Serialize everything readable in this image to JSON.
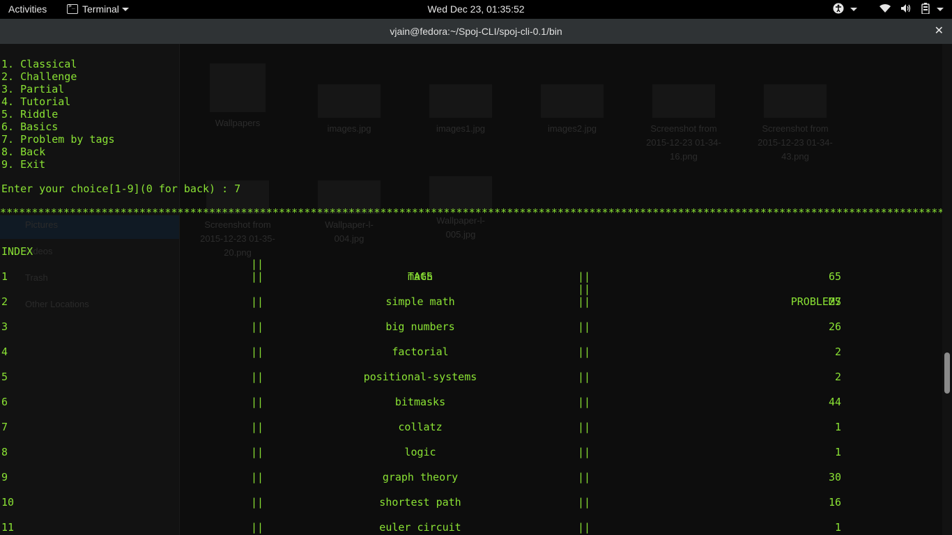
{
  "topbar": {
    "activities": "Activities",
    "app_name": "Terminal",
    "clock": "Wed Dec 23, 01:35:52",
    "icons": [
      "accessibility-icon",
      "wifi-icon",
      "volume-icon",
      "battery-icon"
    ]
  },
  "window": {
    "title": "vjain@fedora:~/Spoj-CLI/spoj-cli-0.1/bin",
    "close_label": "✕"
  },
  "terminal": {
    "menu": [
      "1. Classical",
      "2. Challenge",
      "3. Partial",
      "4. Tutorial",
      "5. Riddle",
      "6. Basics",
      "7. Problem by tags",
      "8. Back",
      "9. Exit"
    ],
    "prompt": "Enter your choice[1-9](0 for back) : 7",
    "stars": "******************************************************************************************************************************************************************************",
    "headers": {
      "index": "INDEX",
      "sep": "||",
      "tags": "TAGS",
      "problems": "PROBLEMS"
    },
    "rows": [
      {
        "index": "1",
        "tag": "math",
        "problems": "65"
      },
      {
        "index": "2",
        "tag": "simple math",
        "problems": "27"
      },
      {
        "index": "3",
        "tag": "big numbers",
        "problems": "26"
      },
      {
        "index": "4",
        "tag": "factorial",
        "problems": "2"
      },
      {
        "index": "5",
        "tag": "positional-systems",
        "problems": "2"
      },
      {
        "index": "6",
        "tag": "bitmasks",
        "problems": "44"
      },
      {
        "index": "7",
        "tag": "collatz",
        "problems": "1"
      },
      {
        "index": "8",
        "tag": "logic",
        "problems": "1"
      },
      {
        "index": "9",
        "tag": "graph theory",
        "problems": "30"
      },
      {
        "index": "10",
        "tag": "shortest path",
        "problems": "16"
      },
      {
        "index": "11",
        "tag": "euler circuit",
        "problems": "1"
      }
    ],
    "text_color": "#8ae234",
    "background_color": "#0d0d0d"
  },
  "background_files": [
    {
      "name": "Wallpapers",
      "kind": "folder"
    },
    {
      "name": "images.jpg",
      "kind": "image"
    },
    {
      "name": "images1.jpg",
      "kind": "image"
    },
    {
      "name": "images2.jpg",
      "kind": "image"
    },
    {
      "name": "Screenshot from 2015-12-23 01-34-16.png",
      "kind": "image"
    },
    {
      "name": "Screenshot from 2015-12-23 01-34-43.png",
      "kind": "image"
    },
    {
      "name": "Screenshot from 2015-12-23 01-35-20.png",
      "kind": "image"
    },
    {
      "name": "Wallpaper-l-004.jpg",
      "kind": "image"
    },
    {
      "name": "Wallpaper-l-005.jpg",
      "kind": "image"
    }
  ],
  "background_sidebar": [
    "Pictures",
    "Videos",
    "Trash",
    "Other Locations"
  ]
}
